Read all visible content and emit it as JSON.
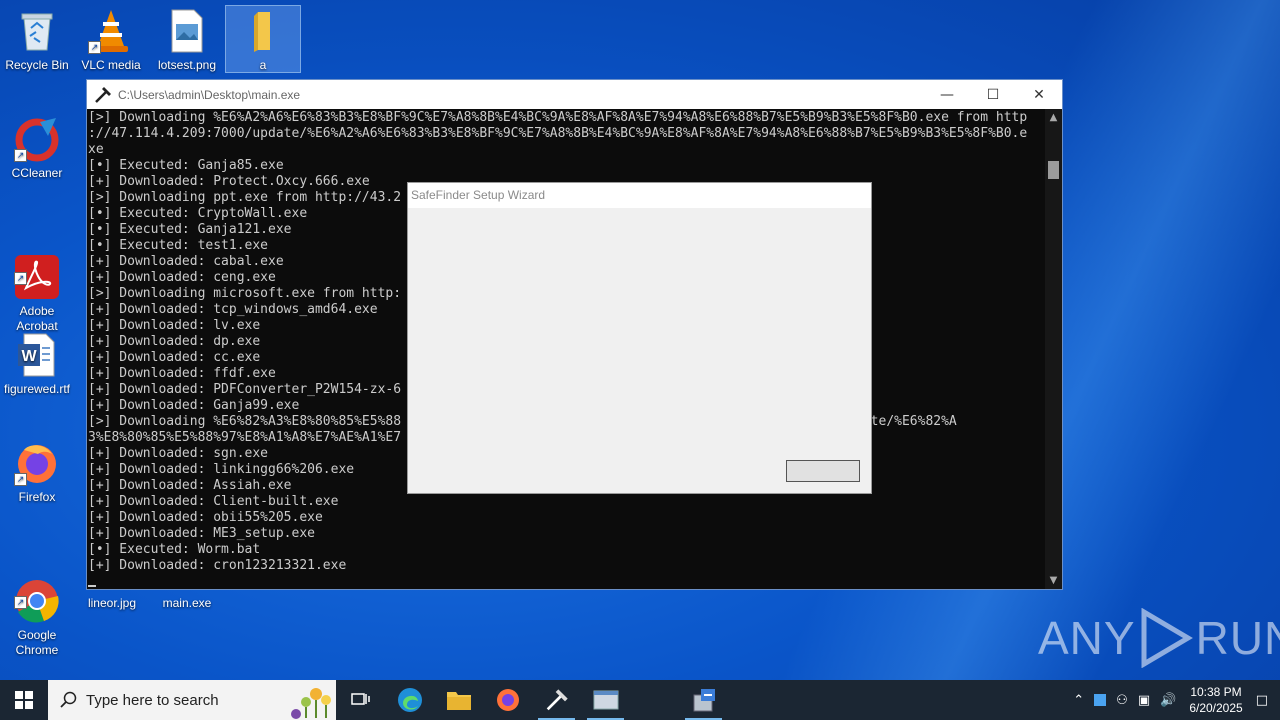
{
  "desktop": {
    "icons": [
      {
        "label": "Recycle Bin"
      },
      {
        "label": "VLC media"
      },
      {
        "label": "lotsest.png"
      },
      {
        "label": "a"
      },
      {
        "label": "CCleaner"
      },
      {
        "label": "Adobe\nAcrobat"
      },
      {
        "label": "figurewed.rtf"
      },
      {
        "label": "Firefox"
      },
      {
        "label": "Google\nChrome"
      },
      {
        "label": "lineor.jpg"
      },
      {
        "label": "main.exe"
      }
    ]
  },
  "console": {
    "title": "C:\\Users\\admin\\Desktop\\main.exe",
    "lines": [
      "[>] Downloading %E6%A2%A6%E6%83%B3%E8%BF%9C%E7%A8%8B%E4%BC%9A%E8%AF%8A%E7%94%A8%E6%88%B7%E5%B9%B3%E5%8F%B0.exe from http",
      "://47.114.4.209:7000/update/%E6%A2%A6%E6%83%B3%E8%BF%9C%E7%A8%8B%E4%BC%9A%E8%AF%8A%E7%94%A8%E6%88%B7%E5%B9%B3%E5%8F%B0.e",
      "xe",
      "[•] Executed: Ganja85.exe",
      "[+] Downloaded: Protect.Oxcy.666.exe",
      "[>] Downloading ppt.exe from http://43.2",
      "[•] Executed: CryptoWall.exe",
      "[•] Executed: Ganja121.exe",
      "[•] Executed: test1.exe",
      "[+] Downloaded: cabal.exe",
      "[+] Downloaded: ceng.exe",
      "[>] Downloading microsoft.exe from http:",
      "[+] Downloaded: tcp_windows_amd64.exe",
      "[+] Downloaded: lv.exe",
      "[+] Downloaded: dp.exe",
      "[+] Downloaded: cc.exe",
      "[+] Downloaded: ffdf.exe",
      "[+] Downloaded: PDFConverter_P2W154-zx-6",
      "[+] Downloaded: Ganja99.exe",
      "[>] Downloading %E6%82%A3%E8%80%85%E5%88                                                 9:7000/update/%E6%82%A",
      "3%E8%80%85%E5%88%97%E8%A1%A8%E7%AE%A1%E7",
      "[+] Downloaded: sgn.exe",
      "[+] Downloaded: linkingg66%206.exe",
      "[+] Downloaded: Assiah.exe",
      "[+] Downloaded: Client-built.exe",
      "[+] Downloaded: obii55%205.exe",
      "[+] Downloaded: ME3_setup.exe",
      "[•] Executed: Worm.bat",
      "[+] Downloaded: cron123213321.exe"
    ]
  },
  "dialog": {
    "title": "SafeFinder Setup Wizard",
    "button_label": ""
  },
  "watermark": {
    "text_left": "ANY",
    "text_right": "RUN"
  },
  "taskbar": {
    "search_placeholder": "Type here to search",
    "time": "10:38 PM",
    "date": "6/20/2025"
  }
}
